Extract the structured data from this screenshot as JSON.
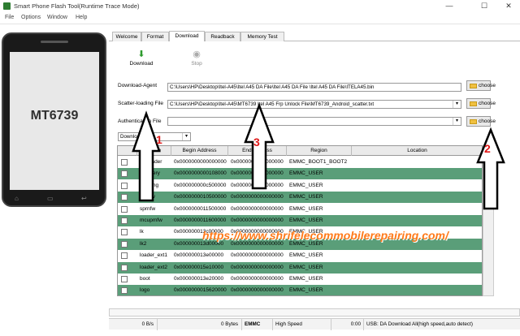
{
  "window": {
    "title": "Smart Phone Flash Tool(Runtime Trace Mode)",
    "minimize": "—",
    "maximize": "☐",
    "close": "✕"
  },
  "menu": [
    "File",
    "Options",
    "Window",
    "Help"
  ],
  "phone": {
    "model": "MT6739",
    "keys": [
      "⌂",
      "▭",
      "↩"
    ]
  },
  "tabs": [
    "Welcome",
    "Format",
    "Download",
    "Readback",
    "Memory Test"
  ],
  "toolbar": {
    "download_label": "Download",
    "stop_label": "Stop"
  },
  "download_agent": {
    "label": "Download-Agent",
    "value": "C:\\Users\\HP\\Desktop\\Itel-A45\\Itel A45 DA File\\Itel A45 DA File \\Itel A45 DA File\\ITELA45.bin",
    "button": "choose"
  },
  "scatter": {
    "label": "Scatter-loading File",
    "value": "C:\\Users\\HP\\Desktop\\Itel-A45\\MT6739 Itel A45 Frp Unlock File\\MT6739_Android_scatter.txt",
    "button": "choose"
  },
  "auth": {
    "label": "Authentication File",
    "value": "",
    "button": "choose"
  },
  "mode": {
    "value": "Download Only"
  },
  "table": {
    "headers": [
      "",
      "Name",
      "Begin Address",
      "End Address",
      "Region",
      "Location"
    ],
    "rows": [
      {
        "checked": false,
        "name": "preloader",
        "begin": "0x0000000000000000",
        "end": "0x0000000000000000",
        "region": "EMMC_BOOT1_BOOT2",
        "location": "",
        "highlight": false
      },
      {
        "checked": false,
        "name": "recovery",
        "begin": "0x0000000000108000",
        "end": "0x0000000000000000",
        "region": "EMMC_USER",
        "location": "",
        "highlight": true
      },
      {
        "checked": false,
        "name": "md1img",
        "begin": "0x000000000c500000",
        "end": "0x0000000000000000",
        "region": "EMMC_USER",
        "location": "",
        "highlight": false
      },
      {
        "checked": false,
        "name": "spmfw",
        "begin": "0x0000000010500000",
        "end": "0x0000000000000000",
        "region": "EMMC_USER",
        "location": "",
        "highlight": true
      },
      {
        "checked": false,
        "name": "sprnfw",
        "begin": "0x0000000011500000",
        "end": "0x0000000000000000",
        "region": "EMMC_USER",
        "location": "",
        "highlight": false
      },
      {
        "checked": false,
        "name": "mcupmfw",
        "begin": "0x0000000011600000",
        "end": "0x0000000000000000",
        "region": "EMMC_USER",
        "location": "",
        "highlight": true
      },
      {
        "checked": false,
        "name": "lk",
        "begin": "0x000000013c00000",
        "end": "0x0000000000000000",
        "region": "EMMC_USER",
        "location": "",
        "highlight": false
      },
      {
        "checked": false,
        "name": "lk2",
        "begin": "0x000000013d00000",
        "end": "0x0000000000000000",
        "region": "EMMC_USER",
        "location": "",
        "highlight": true
      },
      {
        "checked": false,
        "name": "loader_ext1",
        "begin": "0x000000013e00000",
        "end": "0x0000000000000000",
        "region": "EMMC_USER",
        "location": "",
        "highlight": false
      },
      {
        "checked": false,
        "name": "loader_ext2",
        "begin": "0x000000015e10000",
        "end": "0x0000000000000000",
        "region": "EMMC_USER",
        "location": "",
        "highlight": true
      },
      {
        "checked": false,
        "name": "boot",
        "begin": "0x000000013e20000",
        "end": "0x0000000000000000",
        "region": "EMMC_USER",
        "location": "",
        "highlight": false
      },
      {
        "checked": false,
        "name": "logo",
        "begin": "0x0000000015620000",
        "end": "0x0000000000000000",
        "region": "EMMC_USER",
        "location": "",
        "highlight": true
      }
    ]
  },
  "status": {
    "speed": "0 B/s",
    "bytes": "0 Bytes",
    "storage": "EMMC",
    "mode": "High Speed",
    "time": "0:00",
    "usb": "USB: DA Download All(high speed,auto detect)"
  },
  "watermark": "https://www.shrifelecommobilerepairing.com/",
  "annotations": [
    "1",
    "2",
    "3"
  ]
}
